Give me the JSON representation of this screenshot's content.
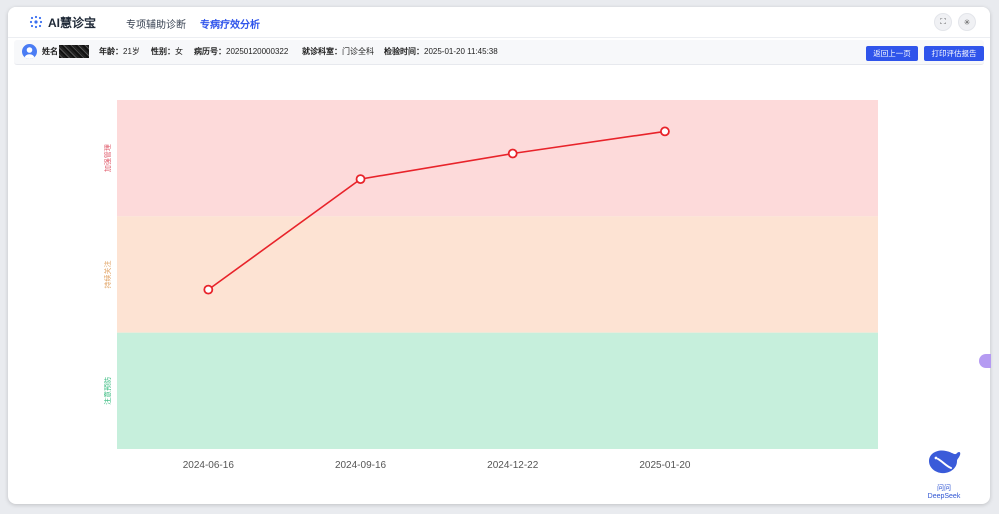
{
  "app": {
    "title": "AI慧诊宝"
  },
  "nav": {
    "tab1": "专项辅助诊断",
    "tab2": "专病疗效分析"
  },
  "top_icons": {
    "fullscreen": "fullscreen-icon",
    "settings": "sun-icon"
  },
  "patient": {
    "name_label": "姓名",
    "age_label": "年龄：",
    "age": "21岁",
    "sex_label": "性别：",
    "sex": "女",
    "record_label": "病历号：",
    "record": "20250120000322",
    "dept_label": "就诊科室：",
    "dept": "门诊全科",
    "time_label": "检验时间：",
    "time": "2025-01-20 11:45:38"
  },
  "buttons": {
    "back": "返回上一页",
    "print": "打印评估报告"
  },
  "chart_data": {
    "type": "line",
    "categories": [
      "2024-06-16",
      "2024-09-16",
      "2024-12-22",
      "2025-01-20"
    ],
    "bands": [
      {
        "label": "加强管理",
        "color": "#fddada",
        "text_color": "#e05a6a"
      },
      {
        "label": "持续关注",
        "color": "#fde3d3",
        "text_color": "#e0a060"
      },
      {
        "label": "注意预防",
        "color": "#c6efdc",
        "text_color": "#2fb87a"
      }
    ],
    "series": [
      {
        "values": [
          1.37,
          2.32,
          2.54,
          2.73
        ]
      }
    ],
    "ylim": [
      0,
      3
    ],
    "line_color": "#e8232a"
  },
  "assistant": {
    "label": "问问DeepSeek"
  }
}
